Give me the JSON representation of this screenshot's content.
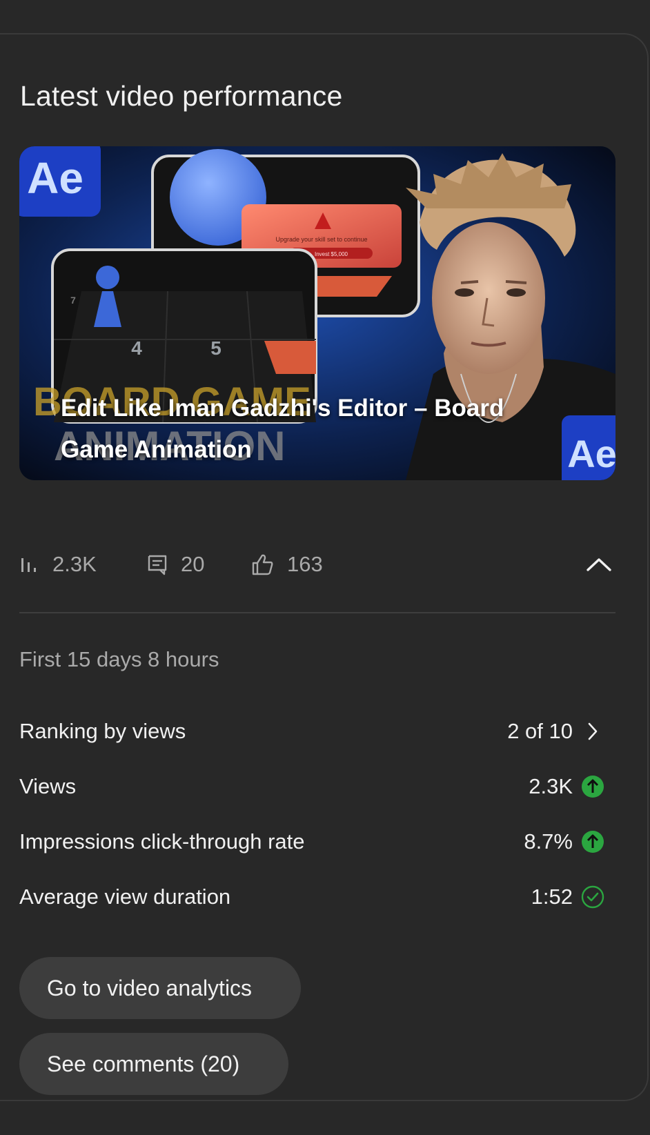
{
  "card": {
    "title": "Latest video performance"
  },
  "video": {
    "title": "Edit Like Iman Gadzhi's Editor – Board Game Animation",
    "thumbnail": {
      "badge_text": "Ae",
      "corner_badge_text": "Ae",
      "background_text_line1": "BOARD GAME",
      "background_text_line2": "ANIMATION",
      "tile_numbers": [
        "4",
        "5",
        "7"
      ],
      "alert_text": "Upgrade your skill set to continue",
      "alert_button": "Invest $5,000",
      "accent_color": "#2a5fd6"
    }
  },
  "stats": {
    "views": "2.3K",
    "comments": "20",
    "likes": "163",
    "views_icon": "bar-chart-icon",
    "comments_icon": "comment-icon",
    "likes_icon": "thumbs-up-icon",
    "collapse_icon": "chevron-up-icon"
  },
  "period": "First 15 days 8 hours",
  "metrics": [
    {
      "label": "Ranking by views",
      "value": "2 of 10",
      "icon": "chevron-right-icon"
    },
    {
      "label": "Views",
      "value": "2.3K",
      "icon": "arrow-up-circle-icon",
      "icon_color": "#2ba640"
    },
    {
      "label": "Impressions click-through rate",
      "value": "8.7%",
      "icon": "arrow-up-circle-icon",
      "icon_color": "#2ba640"
    },
    {
      "label": "Average view duration",
      "value": "1:52",
      "icon": "check-circle-icon",
      "icon_color": "#2ba640"
    }
  ],
  "buttons": {
    "analytics": "Go to video analytics",
    "comments": "See comments (20)"
  }
}
